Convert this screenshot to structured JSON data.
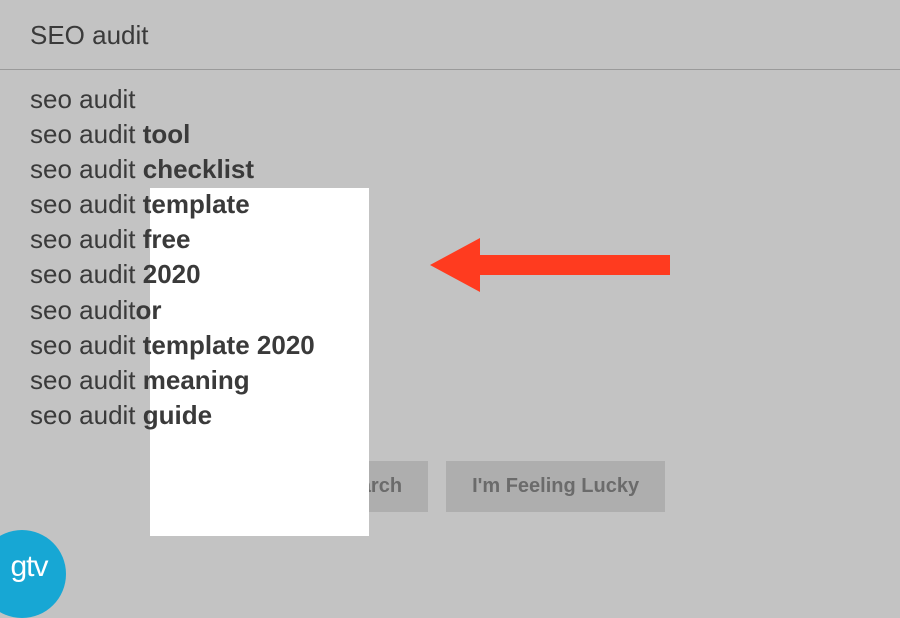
{
  "search": {
    "value": "SEO audit"
  },
  "suggestions": [
    {
      "prefix": "seo audit",
      "completion": ""
    },
    {
      "prefix": "seo audit ",
      "completion": "tool"
    },
    {
      "prefix": "seo audit ",
      "completion": "checklist"
    },
    {
      "prefix": "seo audit ",
      "completion": "template"
    },
    {
      "prefix": "seo audit ",
      "completion": "free"
    },
    {
      "prefix": "seo audit ",
      "completion": "2020"
    },
    {
      "prefix": "seo audit",
      "completion": "or"
    },
    {
      "prefix": "seo audit ",
      "completion": "template 2020"
    },
    {
      "prefix": "seo audit ",
      "completion": "meaning"
    },
    {
      "prefix": "seo audit ",
      "completion": "guide"
    }
  ],
  "buttons": {
    "search": "Google Search",
    "lucky": "I'm Feeling Lucky"
  },
  "logo": {
    "text": "gtv"
  },
  "arrow": {
    "color": "#ff3b1f"
  }
}
